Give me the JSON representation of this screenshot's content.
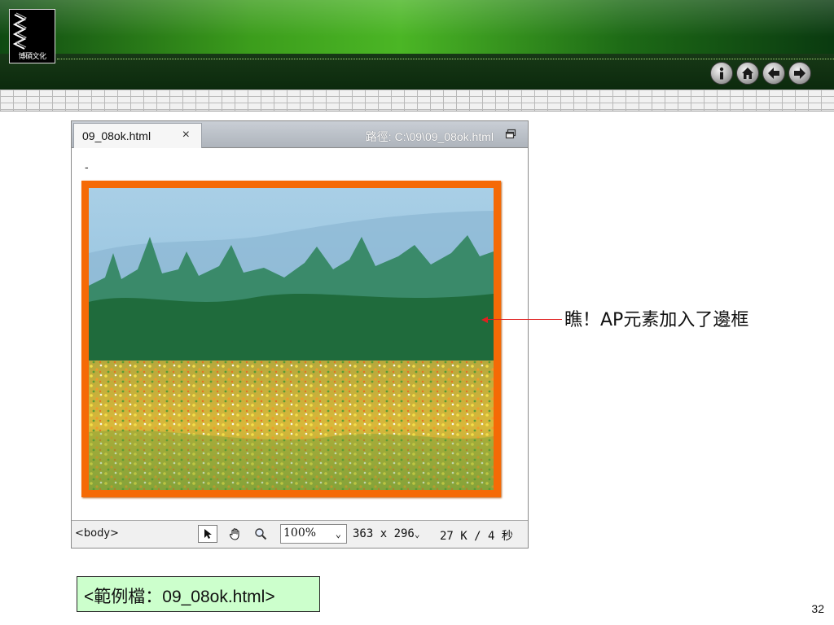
{
  "header": {
    "logo_text": "博碩文化",
    "nav": [
      {
        "icon": "info-icon"
      },
      {
        "icon": "home-icon"
      },
      {
        "icon": "back-arrow-icon"
      },
      {
        "icon": "forward-arrow-icon"
      }
    ]
  },
  "dw_window": {
    "tab_label": "09_08ok.html",
    "tab_close": "×",
    "path_label": "路徑: C:\\09\\09_08ok.html",
    "cursor_mark": "-",
    "status": {
      "tag": "<body>",
      "zoom": "100%",
      "dimensions": "363 x 296",
      "file_size": "27 K / 4 秒"
    }
  },
  "annotation": {
    "text": "瞧！AP元素加入了邊框",
    "color": "#e02020"
  },
  "example_file": "<範例檔：09_08ok.html>",
  "page_number": "32",
  "colors": {
    "ap_border": "#f56a06",
    "example_bg": "#ccffcc"
  }
}
